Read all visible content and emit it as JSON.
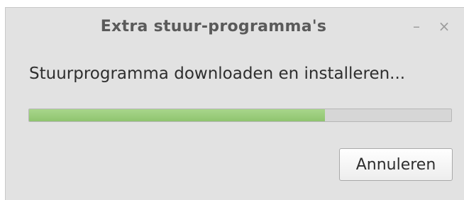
{
  "window": {
    "title": "Extra stuur-programma's",
    "minimize_icon": "minimize-icon",
    "close_icon": "close-icon"
  },
  "dialog": {
    "message": "Stuurprogramma downloaden en installeren...",
    "progress_fraction": 0.7,
    "progress_color": "#97c977",
    "cancel_label": "Annuleren"
  }
}
